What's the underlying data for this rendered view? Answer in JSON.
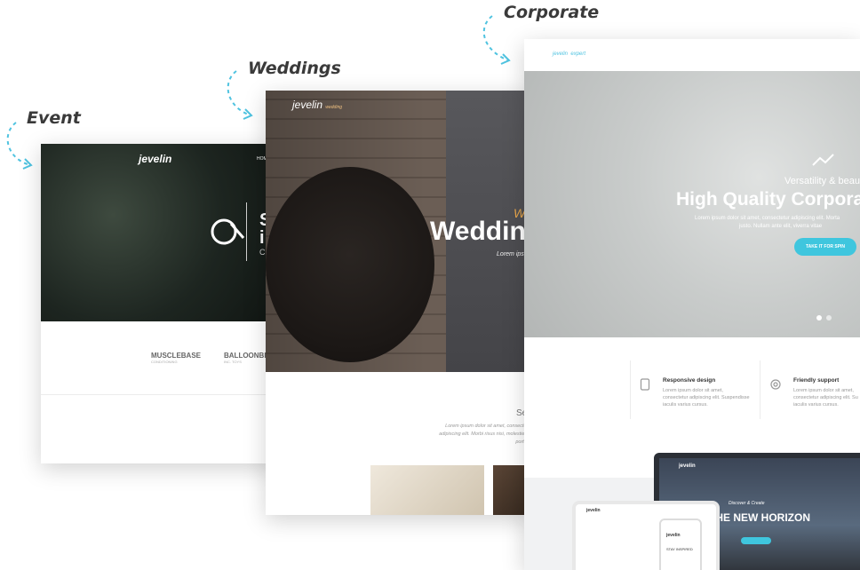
{
  "labels": {
    "event": "Event",
    "weddings": "Weddings",
    "corporate": "Corporate"
  },
  "event_card": {
    "logo": "jevelin",
    "nav_item": "HOME",
    "hero_line1": "S",
    "hero_line2": "i",
    "hero_line3": "C",
    "brands": [
      {
        "name": "MUSCLEBASE",
        "tag": "CONDITIONING"
      },
      {
        "name": "BALLOONBEAR",
        "tag": "INC. TOYS"
      }
    ]
  },
  "wedding_card": {
    "logo": "jevelin",
    "logo_tag": "wedding",
    "script": "W",
    "title": "Weddin",
    "lorem": "Lorem ipsum dolor convallis",
    "section_heading": "Se",
    "section_text": "Lorem ipsum dolor sit amet, consectetur adipiscing elit. Morbi risus nisi, molestie elit porttitor"
  },
  "corporate_card": {
    "logo": "jevelin",
    "logo_tag": "expert",
    "kicker": "Versatility & beaut",
    "title": "High Quality Corpora",
    "lorem_line1": "Lorem ipsum dolor sit amet, consectetur adipiscing elit. Morta",
    "lorem_line2": "justo. Nullam ante elit, viverra vitae",
    "cta": "TAKE IT FOR SPIN",
    "features": [
      {
        "title": "Responsive design",
        "text_line1": "Lorem ipsum dolor sit amet,",
        "text_line2": "consectetur adipiscing elit. Suspendisse",
        "text_line3": "iaculis varius cursus."
      },
      {
        "title": "Friendly support",
        "text_line1": "Lorem ipsum dolor sit amet,",
        "text_line2": "consectetur adipiscing elit. Su",
        "text_line3": "iaculis varius cursus."
      }
    ],
    "monitor_logo": "jevelin",
    "monitor_small": "Discover & Create",
    "monitor_title": "THE NEW HORIZON",
    "tablet_logo": "jevelin",
    "phone_logo": "jevelin",
    "phone_tag": "STAY INSPIRED"
  },
  "colors": {
    "accent": "#3fc6de",
    "wedding_script": "#e7a64c",
    "label": "#3a3a3a"
  }
}
